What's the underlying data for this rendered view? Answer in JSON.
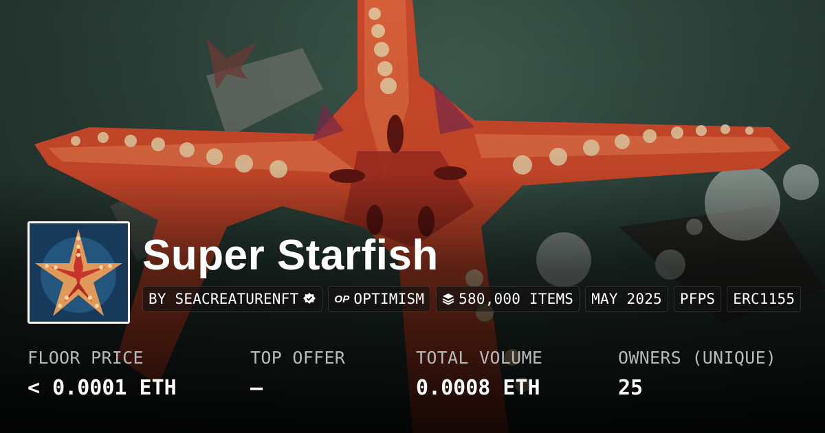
{
  "collection": {
    "title": "Super Starfish"
  },
  "chips": {
    "creator": "BY SEACREATURENFT",
    "chain": "OPTIMISM",
    "chain_badge": "OP",
    "items": "580,000 ITEMS",
    "date": "MAY 2025",
    "category": "PFPS",
    "standard": "ERC1155"
  },
  "stats": {
    "floor_price": {
      "label": "FLOOR PRICE",
      "value": "< 0.0001 ETH"
    },
    "top_offer": {
      "label": "TOP OFFER",
      "value": "–"
    },
    "total_volume": {
      "label": "TOTAL VOLUME",
      "value": "0.0008 ETH"
    },
    "owners": {
      "label": "OWNERS (UNIQUE)",
      "value": "25"
    }
  },
  "icons": {
    "verified": "verified-badge-icon",
    "chain": "optimism-icon",
    "items": "layers-icon"
  },
  "colors": {
    "starfish": "#c8472a",
    "background": "#2a3f37",
    "text": "#ffffff",
    "label": "#b9b9b9"
  }
}
